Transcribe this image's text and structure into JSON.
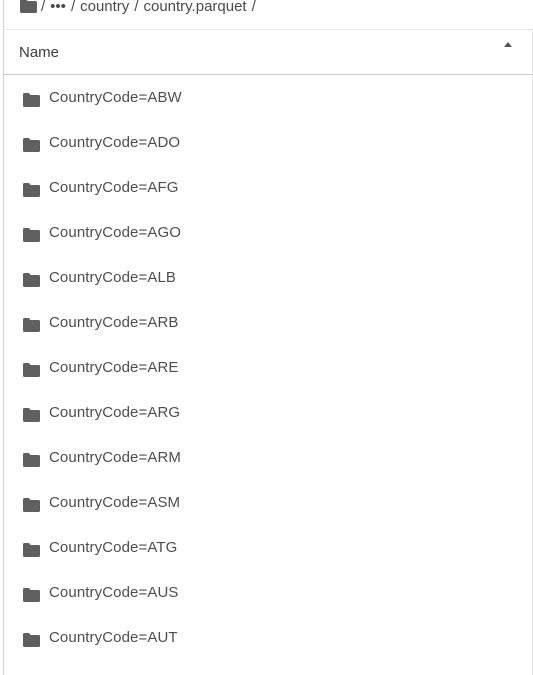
{
  "breadcrumb": {
    "sep_1": "/",
    "ellipsis": "•••",
    "sep_2": "/",
    "item_country": "country",
    "sep_3": "/",
    "item_parquet": "country.parquet",
    "sep_4": "/"
  },
  "table": {
    "header": {
      "name_label": "Name",
      "sort": "ascending"
    },
    "rows": [
      {
        "label": "CountryCode=ABW",
        "icon": "folder-icon"
      },
      {
        "label": "CountryCode=ADO",
        "icon": "folder-icon"
      },
      {
        "label": "CountryCode=AFG",
        "icon": "folder-icon"
      },
      {
        "label": "CountryCode=AGO",
        "icon": "folder-icon"
      },
      {
        "label": "CountryCode=ALB",
        "icon": "folder-icon"
      },
      {
        "label": "CountryCode=ARB",
        "icon": "folder-icon"
      },
      {
        "label": "CountryCode=ARE",
        "icon": "folder-icon"
      },
      {
        "label": "CountryCode=ARG",
        "icon": "folder-icon"
      },
      {
        "label": "CountryCode=ARM",
        "icon": "folder-icon"
      },
      {
        "label": "CountryCode=ASM",
        "icon": "folder-icon"
      },
      {
        "label": "CountryCode=ATG",
        "icon": "folder-icon"
      },
      {
        "label": "CountryCode=AUS",
        "icon": "folder-icon"
      },
      {
        "label": "CountryCode=AUT",
        "icon": "folder-icon"
      }
    ]
  },
  "colors": {
    "icon": "#5f5f5f",
    "text": "#4d4d4d",
    "header_border": "#c9c9c9"
  }
}
